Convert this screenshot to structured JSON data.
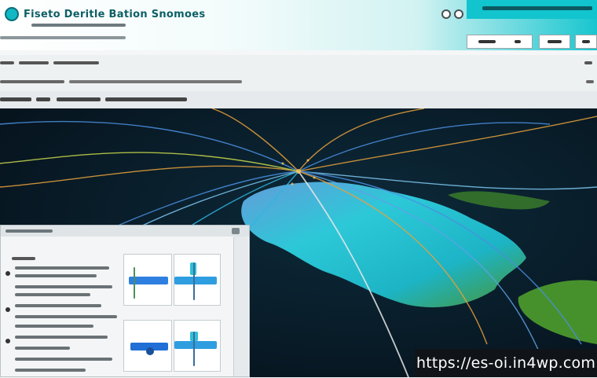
{
  "app": {
    "title": "Fiseto Deritle Bation Snomoes",
    "logo_icon": "globe-logo-icon"
  },
  "header_icons": [
    "help-icon",
    "settings-icon"
  ],
  "side_panel_cards": [
    "chart-card-top",
    "chart-card-bottom"
  ],
  "watermark": {
    "url": "https://es-oi.in4wp.com"
  },
  "colors": {
    "accent": "#12c4ce",
    "map_background": "#081a26",
    "land_cyan": "#2fd6e6",
    "land_green": "#4f9e2e",
    "flow_orange": "#e9a23b",
    "flow_blue": "#4a8fe0"
  }
}
